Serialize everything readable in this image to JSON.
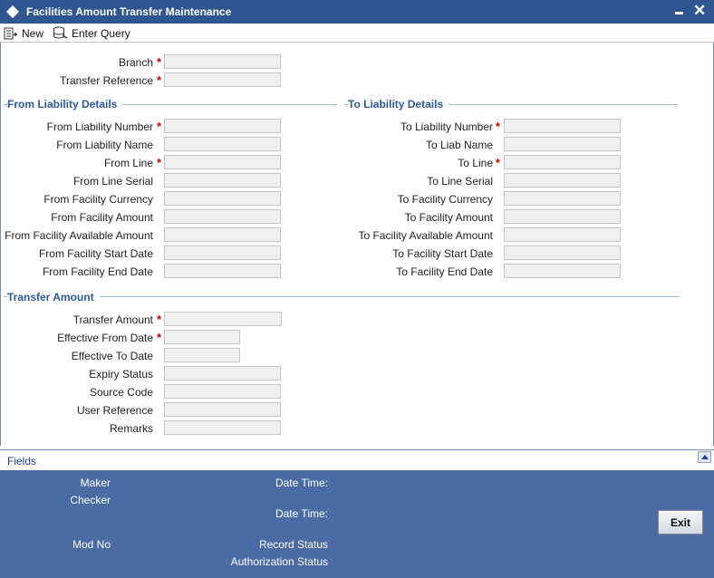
{
  "window": {
    "title": "Facilities Amount Transfer Maintenance"
  },
  "toolbar": {
    "new_label": "New",
    "enter_query_label": "Enter Query"
  },
  "header_fields": {
    "branch_label": "Branch",
    "transfer_reference_label": "Transfer Reference"
  },
  "from_section": {
    "title": "From Liability Details",
    "liability_number_label": "From Liability Number",
    "liability_name_label": "From Liability Name",
    "line_label": "From Line",
    "line_serial_label": "From Line Serial",
    "facility_currency_label": "From Facility Currency",
    "facility_amount_label": "From Facility Amount",
    "facility_available_amount_label": "From Facility Available Amount",
    "facility_start_date_label": "From Facility Start Date",
    "facility_end_date_label": "From Facility End Date"
  },
  "to_section": {
    "title": "To Liability Details",
    "liability_number_label": "To Liability Number",
    "liab_name_label": "To Liab Name",
    "line_label": "To Line",
    "line_serial_label": "To Line Serial",
    "facility_currency_label": "To Facility Currency",
    "facility_amount_label": "To Facility Amount",
    "facility_available_amount_label": "To Facility Available Amount",
    "facility_start_date_label": "To Facility Start Date",
    "facility_end_date_label": "To Facility End Date"
  },
  "transfer_section": {
    "title": "Transfer Amount",
    "transfer_amount_label": "Transfer Amount",
    "effective_from_date_label": "Effective From Date",
    "effective_to_date_label": "Effective To Date",
    "expiry_status_label": "Expiry Status",
    "source_code_label": "Source Code",
    "user_reference_label": "User Reference",
    "remarks_label": "Remarks"
  },
  "required_marker": "*",
  "fields_bar": {
    "label": "Fields"
  },
  "footer": {
    "maker_label": "Maker",
    "checker_label": "Checker",
    "date_time_label_1": "Date Time:",
    "date_time_label_2": "Date Time:",
    "mod_no_label": "Mod No",
    "record_status_label": "Record Status",
    "authorization_status_label": "Authorization Status",
    "exit_label": "Exit"
  },
  "colors": {
    "title_bar": "#2f5690",
    "section_header": "#2e5c9a",
    "footer": "#4a6ba3",
    "required": "#d10000"
  }
}
